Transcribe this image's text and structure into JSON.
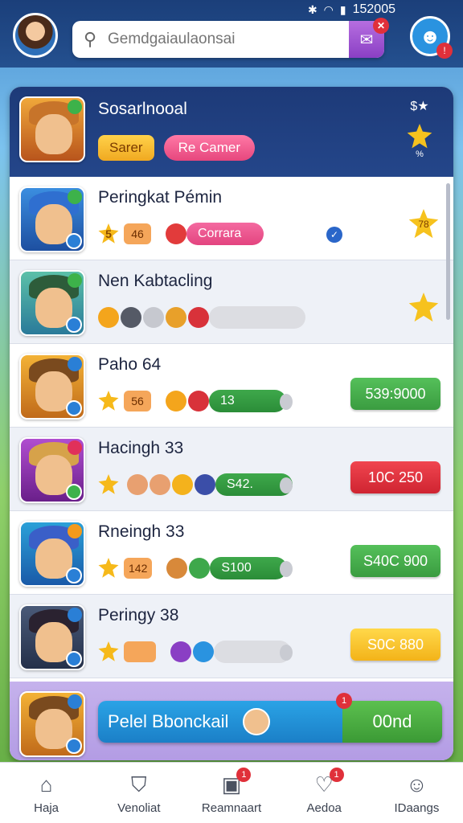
{
  "status": {
    "time": "152005",
    "icons": [
      "bluetooth-icon",
      "wifi-icon",
      "signal-icon"
    ]
  },
  "search": {
    "placeholder": "Gemdgaiaulaonsai"
  },
  "header": {
    "title": "Sosarlnooal",
    "btn_primary": "Sarer",
    "btn_secondary": "Re Camer",
    "corner_text": "$★",
    "star_caption": "%"
  },
  "rows": [
    {
      "name": "Peringkat Pémin",
      "stars": "5",
      "num": "46",
      "pill": "Corrara",
      "pill_style": "pink",
      "reward": "",
      "star_right": "78"
    },
    {
      "name": "Nen Kabtacling",
      "stars": "",
      "num": "",
      "pill": "",
      "pill_style": "grey",
      "reward": "",
      "star_right": ""
    },
    {
      "name": "Paho 64",
      "stars": "",
      "num": "56",
      "pill": "13",
      "pill_style": "green",
      "reward": "539:9000",
      "reward_style": "green"
    },
    {
      "name": "Hacingh 33",
      "stars": "",
      "num": "",
      "pill": "S42.",
      "pill_style": "green",
      "reward": "10C 250",
      "reward_style": "red"
    },
    {
      "name": "Rneingh 33",
      "stars": "",
      "num": "142",
      "pill": "S100",
      "pill_style": "green",
      "reward": "S40C 900",
      "reward_style": "green"
    },
    {
      "name": "Peringy 38",
      "stars": "",
      "num": "",
      "pill": "",
      "pill_style": "grey",
      "reward": "S0C 880",
      "reward_style": "yellow"
    }
  ],
  "footer": {
    "label": "Pelel Bbonckail",
    "ok": "00nd",
    "badge": "1"
  },
  "nav": [
    {
      "label": "Haja",
      "icon": "home-icon",
      "badge": ""
    },
    {
      "label": "Venoliat",
      "icon": "shield-icon",
      "badge": ""
    },
    {
      "label": "Reamnaart",
      "icon": "game-icon",
      "badge": "1"
    },
    {
      "label": "Aedoa",
      "icon": "heart-chat-icon",
      "badge": "1"
    },
    {
      "label": "IDaangs",
      "icon": "user-icon",
      "badge": ""
    }
  ],
  "colors": {
    "brand_dark": "#1d3a78",
    "green": "#3ea84b",
    "red": "#e0303a",
    "gold": "#f6c21e"
  }
}
